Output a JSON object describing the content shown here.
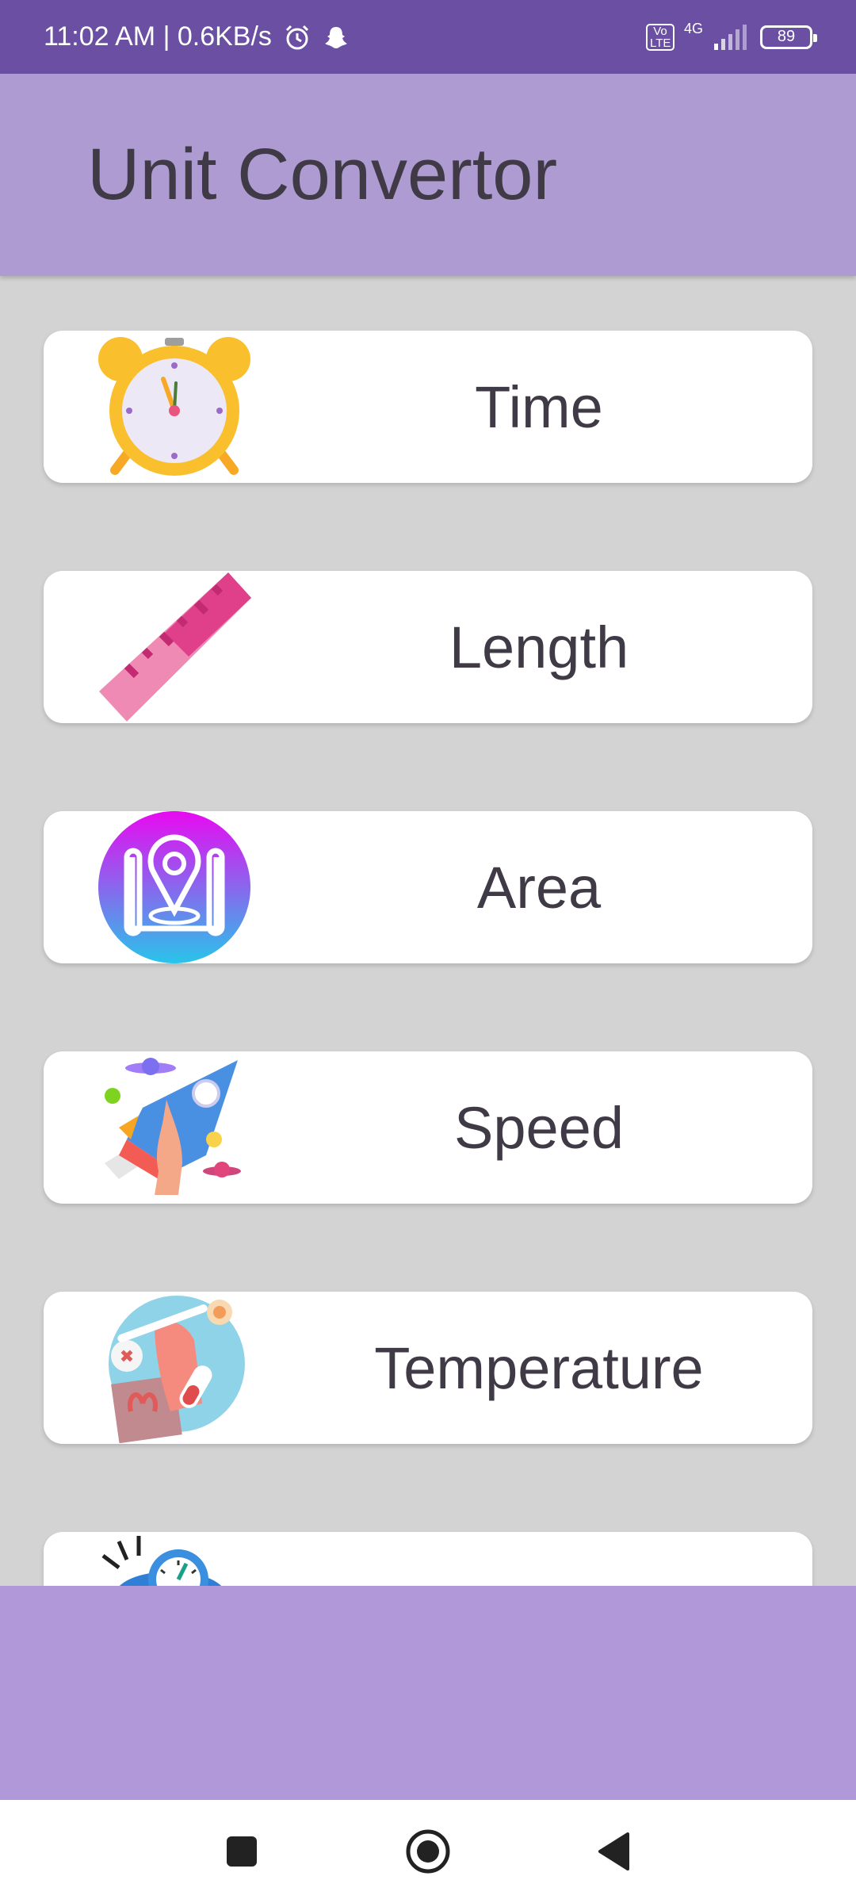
{
  "status_bar": {
    "time_speed": "11:02 AM | 0.6KB/s",
    "volte_top": "Vo",
    "volte_bottom": "LTE",
    "network": "4G",
    "battery": "89"
  },
  "app_bar": {
    "title": "Unit Convertor"
  },
  "converters": [
    {
      "label": "Time",
      "icon": "alarm-clock-icon"
    },
    {
      "label": "Length",
      "icon": "ruler-icon"
    },
    {
      "label": "Area",
      "icon": "map-pin-icon"
    },
    {
      "label": "Speed",
      "icon": "rocket-icon"
    },
    {
      "label": "Temperature",
      "icon": "thermometer-icon"
    },
    {
      "label": "",
      "icon": "pressure-gauge-icon"
    }
  ],
  "nav_bar": {
    "items": [
      "recent-apps",
      "home",
      "back"
    ]
  },
  "colors": {
    "status_bar": "#6a4fa3",
    "app_bar": "#ad9bd1",
    "background": "#d3d3d3",
    "bottom_panel": "#b198d9"
  }
}
